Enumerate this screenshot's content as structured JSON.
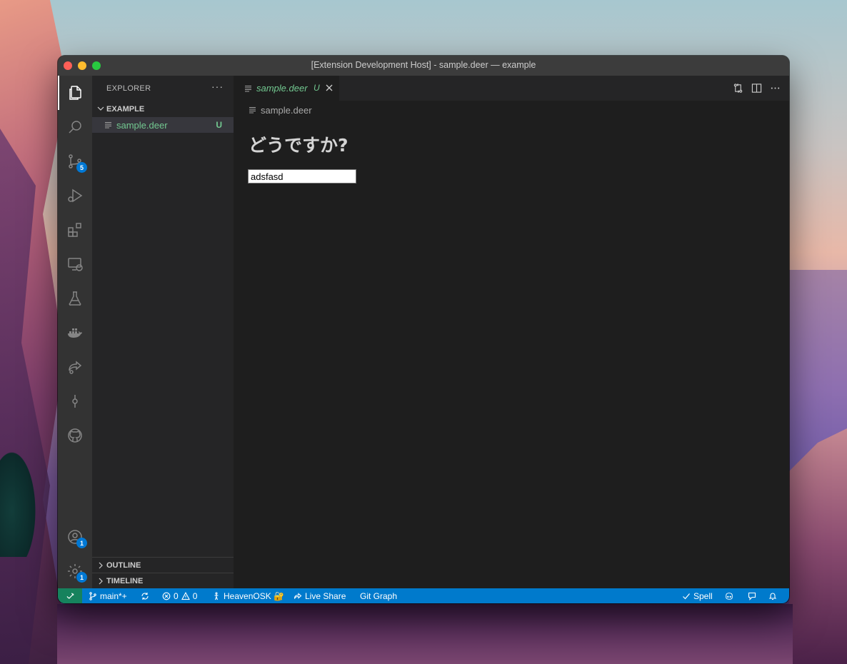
{
  "window": {
    "title": "[Extension Development Host] - sample.deer — example"
  },
  "activity_bar": {
    "items": [
      {
        "name": "explorer-icon",
        "active": true
      },
      {
        "name": "search-icon"
      },
      {
        "name": "source-control-icon",
        "badge": "5"
      },
      {
        "name": "run-debug-icon"
      },
      {
        "name": "extensions-icon"
      },
      {
        "name": "remote-explorer-icon"
      },
      {
        "name": "testing-icon"
      },
      {
        "name": "docker-icon"
      },
      {
        "name": "live-share-icon"
      },
      {
        "name": "git-commit-icon"
      },
      {
        "name": "github-icon"
      }
    ],
    "bottom": [
      {
        "name": "accounts-icon",
        "badge": "1"
      },
      {
        "name": "settings-gear-icon",
        "badge": "1"
      }
    ]
  },
  "sidebar": {
    "header": "EXPLORER",
    "more": "···",
    "folder": "EXAMPLE",
    "files": [
      {
        "name": "sample.deer",
        "status": "U"
      }
    ],
    "sections": [
      "OUTLINE",
      "TIMELINE"
    ]
  },
  "editor": {
    "tab": {
      "label": "sample.deer",
      "status": "U"
    },
    "breadcrumb": "sample.deer",
    "heading": "どうですか?",
    "input_value": "adsfasd"
  },
  "status_bar": {
    "branch": "main*+",
    "errors": "0",
    "warnings": "0",
    "user": "HeavenOSK 🔐",
    "live_share": "Live Share",
    "git_graph": "Git Graph",
    "spell": "Spell"
  },
  "colors": {
    "accent": "#007acc",
    "remote": "#16825d",
    "untracked": "#73c991",
    "badge": "#0078d4"
  }
}
